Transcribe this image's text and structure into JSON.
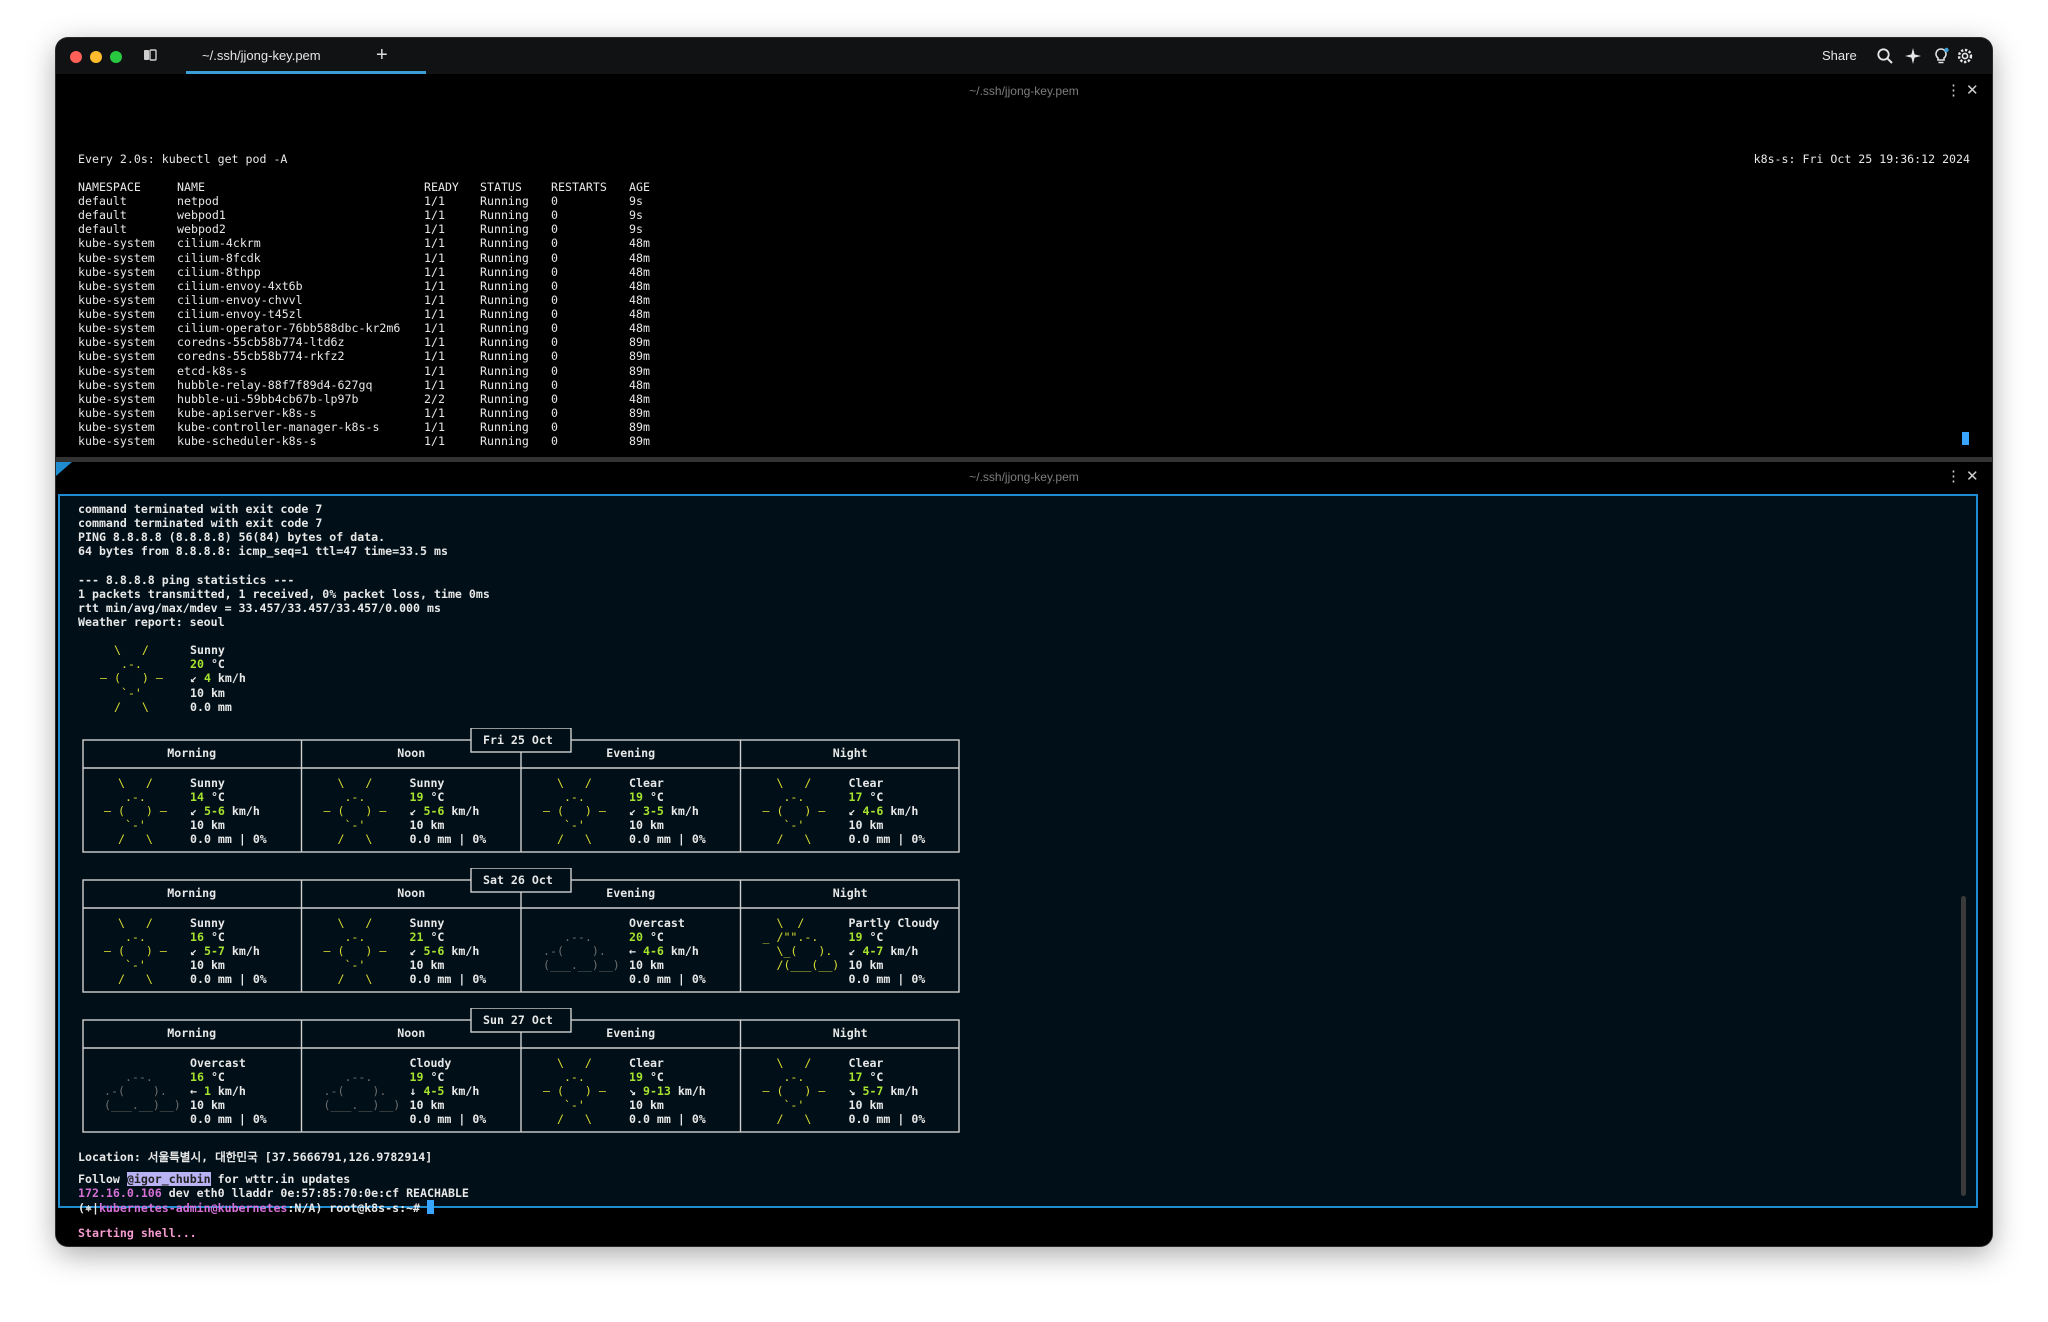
{
  "window": {
    "tab_title": "~/.ssh/jjong-key.pem",
    "new_tab_icon": "plus-icon",
    "share_label": "Share",
    "toolbar_icons": [
      "search-icon",
      "sparkle-icon",
      "bulb-icon",
      "gear-icon"
    ]
  },
  "top_pane": {
    "header": "~/.ssh/jjong-key.pem",
    "watch_cmd": "Every 2.0s: kubectl get pod -A",
    "watch_host": "k8s-s: Fri Oct 25 19:36:12 2024",
    "columns": [
      "NAMESPACE",
      "NAME",
      "READY",
      "STATUS",
      "RESTARTS",
      "AGE"
    ],
    "rows": [
      [
        "default",
        "netpod",
        "1/1",
        "Running",
        "0",
        "9s"
      ],
      [
        "default",
        "webpod1",
        "1/1",
        "Running",
        "0",
        "9s"
      ],
      [
        "default",
        "webpod2",
        "1/1",
        "Running",
        "0",
        "9s"
      ],
      [
        "kube-system",
        "cilium-4ckrm",
        "1/1",
        "Running",
        "0",
        "48m"
      ],
      [
        "kube-system",
        "cilium-8fcdk",
        "1/1",
        "Running",
        "0",
        "48m"
      ],
      [
        "kube-system",
        "cilium-8thpp",
        "1/1",
        "Running",
        "0",
        "48m"
      ],
      [
        "kube-system",
        "cilium-envoy-4xt6b",
        "1/1",
        "Running",
        "0",
        "48m"
      ],
      [
        "kube-system",
        "cilium-envoy-chvvl",
        "1/1",
        "Running",
        "0",
        "48m"
      ],
      [
        "kube-system",
        "cilium-envoy-t45zl",
        "1/1",
        "Running",
        "0",
        "48m"
      ],
      [
        "kube-system",
        "cilium-operator-76bb588dbc-kr2m6",
        "1/1",
        "Running",
        "0",
        "48m"
      ],
      [
        "kube-system",
        "coredns-55cb58b774-ltd6z",
        "1/1",
        "Running",
        "0",
        "89m"
      ],
      [
        "kube-system",
        "coredns-55cb58b774-rkfz2",
        "1/1",
        "Running",
        "0",
        "89m"
      ],
      [
        "kube-system",
        "etcd-k8s-s",
        "1/1",
        "Running",
        "0",
        "89m"
      ],
      [
        "kube-system",
        "hubble-relay-88f7f89d4-627gq",
        "1/1",
        "Running",
        "0",
        "48m"
      ],
      [
        "kube-system",
        "hubble-ui-59bb4cb67b-lp97b",
        "2/2",
        "Running",
        "0",
        "48m"
      ],
      [
        "kube-system",
        "kube-apiserver-k8s-s",
        "1/1",
        "Running",
        "0",
        "89m"
      ],
      [
        "kube-system",
        "kube-controller-manager-k8s-s",
        "1/1",
        "Running",
        "0",
        "89m"
      ],
      [
        "kube-system",
        "kube-scheduler-k8s-s",
        "1/1",
        "Running",
        "0",
        "89m"
      ]
    ]
  },
  "bottom_pane": {
    "header": "~/.ssh/jjong-key.pem",
    "output_lines": [
      "command terminated with exit code 7",
      "command terminated with exit code 7",
      "PING 8.8.8.8 (8.8.8.8) 56(84) bytes of data.",
      "64 bytes from 8.8.8.8: icmp_seq=1 ttl=47 time=33.5 ms",
      "",
      "--- 8.8.8.8 ping statistics ---",
      "1 packets transmitted, 1 received, 0% packet loss, time 0ms",
      "rtt min/avg/max/mdev = 33.457/33.457/33.457/0.000 ms",
      "Weather report: seoul"
    ],
    "current": {
      "cond": "Sunny",
      "temp": "20",
      "wind_arrow": "↙",
      "wind": "4",
      "vis": "10 km",
      "precip": "0.0 mm"
    },
    "periods": [
      "Morning",
      "Noon",
      "Evening",
      "Night"
    ],
    "days": [
      {
        "date": "Fri 25 Oct",
        "cells": [
          {
            "icon": "sun",
            "cond": "Sunny",
            "temp": "14",
            "arrow": "↙",
            "wind": "5-6",
            "vis": "10 km",
            "precip": "0.0 mm | 0%"
          },
          {
            "icon": "sun",
            "cond": "Sunny",
            "temp": "19",
            "arrow": "↙",
            "wind": "5-6",
            "vis": "10 km",
            "precip": "0.0 mm | 0%"
          },
          {
            "icon": "sun",
            "cond": "Clear",
            "temp": "19",
            "arrow": "↙",
            "wind": "3-5",
            "vis": "10 km",
            "precip": "0.0 mm | 0%"
          },
          {
            "icon": "sun",
            "cond": "Clear",
            "temp": "17",
            "arrow": "↙",
            "wind": "4-6",
            "vis": "10 km",
            "precip": "0.0 mm | 0%"
          }
        ]
      },
      {
        "date": "Sat 26 Oct",
        "cells": [
          {
            "icon": "sun",
            "cond": "Sunny",
            "temp": "16",
            "arrow": "↙",
            "wind": "5-7",
            "vis": "10 km",
            "precip": "0.0 mm | 0%"
          },
          {
            "icon": "sun",
            "cond": "Sunny",
            "temp": "21",
            "arrow": "↙",
            "wind": "5-6",
            "vis": "10 km",
            "precip": "0.0 mm | 0%"
          },
          {
            "icon": "cloud",
            "cond": "Overcast",
            "temp": "20",
            "arrow": "←",
            "wind": "4-6",
            "vis": "10 km",
            "precip": "0.0 mm | 0%"
          },
          {
            "icon": "partly",
            "cond": "Partly Cloudy",
            "temp": "19",
            "arrow": "↙",
            "wind": "4-7",
            "vis": "10 km",
            "precip": "0.0 mm | 0%"
          }
        ]
      },
      {
        "date": "Sun 27 Oct",
        "cells": [
          {
            "icon": "cloud",
            "cond": "Overcast",
            "temp": "16",
            "arrow": "←",
            "wind": "1",
            "vis": "10 km",
            "precip": "0.0 mm | 0%"
          },
          {
            "icon": "cloud",
            "cond": "Cloudy",
            "temp": "19",
            "arrow": "↓",
            "wind": "4-5",
            "vis": "10 km",
            "precip": "0.0 mm | 0%"
          },
          {
            "icon": "sun",
            "cond": "Clear",
            "temp": "19",
            "arrow": "↘",
            "wind": "9-13",
            "vis": "10 km",
            "precip": "0.0 mm | 0%"
          },
          {
            "icon": "sun",
            "cond": "Clear",
            "temp": "17",
            "arrow": "↘",
            "wind": "5-7",
            "vis": "10 km",
            "precip": "0.0 mm | 0%"
          }
        ]
      }
    ],
    "location": "Location: 서울특별시, 대한민국 [37.5666791,126.9782914]",
    "follow_prefix": "Follow ",
    "follow_handle": "@igor_chubin",
    "follow_suffix": " for wttr.in updates",
    "arp_ip": "172.16.0.106",
    "arp_rest": " dev eth0 lladdr 0e:57:85:70:0e:cf REACHABLE",
    "prompt_prefix": "(⎈|",
    "prompt_ctx": "kubernetes-admin@kubernetes",
    "prompt_suffix": ":N/A) root@k8s-s:~# ",
    "starting_shell": "Starting shell..."
  }
}
